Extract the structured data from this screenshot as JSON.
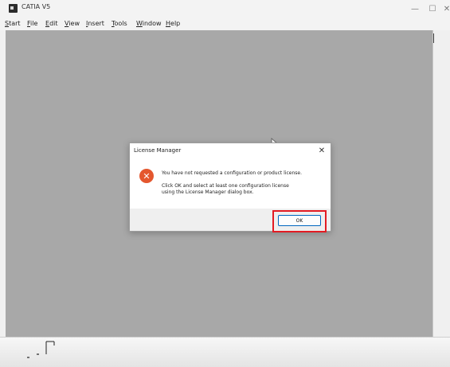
{
  "window": {
    "title": "CATIA V5",
    "minimize_glyph": "—",
    "maximize_glyph": "☐",
    "close_glyph": "✕"
  },
  "menu": {
    "items": [
      {
        "label": "Start",
        "mnemonic_index": 0
      },
      {
        "label": "File",
        "mnemonic_index": 0
      },
      {
        "label": "Edit",
        "mnemonic_index": 0
      },
      {
        "label": "View",
        "mnemonic_index": 0
      },
      {
        "label": "Insert",
        "mnemonic_index": 0
      },
      {
        "label": "Tools",
        "mnemonic_index": 0
      },
      {
        "label": "Window",
        "mnemonic_index": 0
      },
      {
        "label": "Help",
        "mnemonic_index": 0
      }
    ]
  },
  "dialog": {
    "title": "License Manager",
    "close_glyph": "✕",
    "icon": "error-icon",
    "message_line1": "You have not requested a configuration or product license.",
    "message_line2": "Click OK and select at least one configuration license using the License Manager dialog box.",
    "ok_label": "OK"
  },
  "colors": {
    "workspace_bg": "#a8a8a8",
    "error_icon": "#e4572e",
    "highlight": "#e31b23",
    "ok_border": "#0067c0"
  },
  "icons": [
    "catia-app-icon",
    "error-icon",
    "compass-icon",
    "mouse-cursor-icon",
    "close-icon"
  ]
}
